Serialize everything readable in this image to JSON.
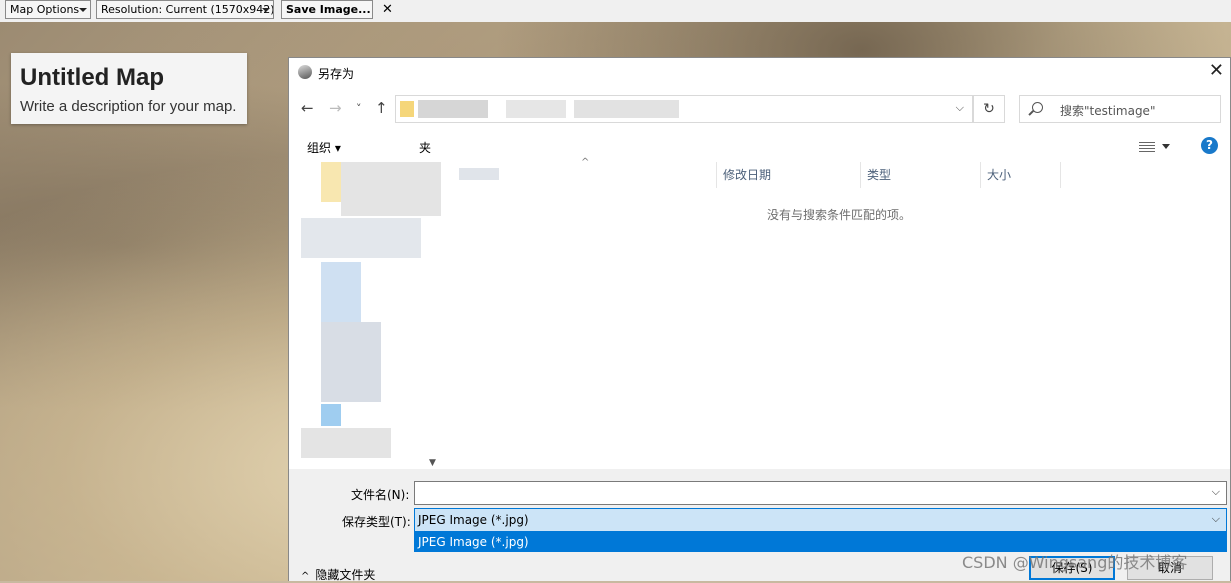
{
  "toolbar": {
    "map_options": "Map Options",
    "resolution": "Resolution: Current (1570x942)",
    "save_image": "Save Image...",
    "close": "✕"
  },
  "map": {
    "title": "Untitled Map",
    "description": "Write a description for your map."
  },
  "dialog": {
    "title": "另存为",
    "close": "✕",
    "nav": {
      "back": "←",
      "forward": "→",
      "recent": "˅",
      "up": "↑"
    },
    "address_chevron": "⌵",
    "refresh": "↻",
    "search_placeholder": "搜索\"testimage\"",
    "organize": "组织 ▾",
    "new_folder": "夹",
    "help": "?",
    "columns": [
      "修改日期",
      "类型",
      "大小"
    ],
    "empty_message": "没有与搜索条件匹配的项。",
    "file_name_label": "文件名(N):",
    "file_name_value": "",
    "save_type_label": "保存类型(T):",
    "save_type_value": "JPEG Image (*.jpg)",
    "save_type_options": [
      "JPEG Image (*.jpg)"
    ],
    "hide_folders": "隐藏文件夹",
    "save_button": "保存(S)",
    "cancel_button": "取消"
  },
  "watermark": "CSDN @Wingsang的技术博客",
  "colors": {
    "accent": "#0078d7",
    "help": "#1979ca",
    "selected_field": "#cce4f7"
  }
}
